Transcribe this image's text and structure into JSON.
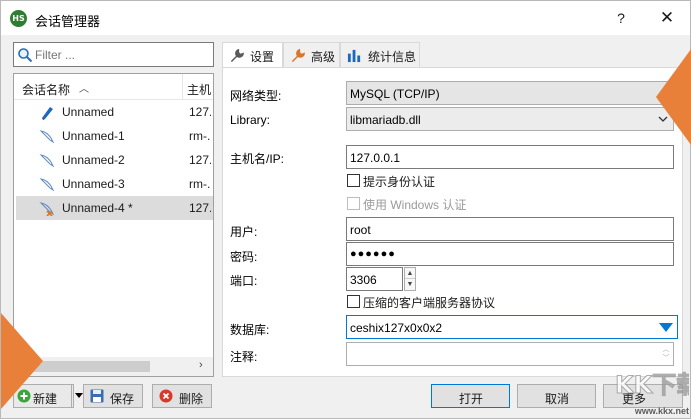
{
  "window": {
    "title": "会话管理器",
    "app_icon_text": "HS",
    "help_label": "?",
    "close_label": "✕"
  },
  "filter": {
    "placeholder": "Filter ..."
  },
  "session_list": {
    "columns": [
      "会话名称",
      "主机"
    ],
    "sessions": [
      {
        "name": "Unnamed",
        "host": "127.",
        "icon": "dolphin-icon-blue",
        "selected": false
      },
      {
        "name": "Unnamed-1",
        "host": "rm-.",
        "icon": "dolphin-icon-gray",
        "selected": false
      },
      {
        "name": "Unnamed-2",
        "host": "127.",
        "icon": "dolphin-icon-gray",
        "selected": false
      },
      {
        "name": "Unnamed-3",
        "host": "rm-.",
        "icon": "dolphin-icon-gray",
        "selected": false
      },
      {
        "name": "Unnamed-4 *",
        "host": "127.",
        "icon": "dolphin-icon-orange",
        "selected": true
      }
    ]
  },
  "tabs": [
    {
      "label": "设置",
      "icon": "wrench-icon",
      "active": true
    },
    {
      "label": "高级",
      "icon": "wrench-orange-icon",
      "active": false
    },
    {
      "label": "统计信息",
      "icon": "bar-chart-icon",
      "active": false
    }
  ],
  "settings": {
    "network_type_label": "网络类型:",
    "network_type_value": "MySQL (TCP/IP)",
    "library_label": "Library:",
    "library_value": "libmariadb.dll",
    "hostname_label": "主机名/IP:",
    "hostname_value": "127.0.0.1",
    "prompt_auth_label": "提示身份认证",
    "windows_auth_label": "使用 Windows 认证",
    "user_label": "用户:",
    "user_value": "root",
    "password_label": "密码:",
    "password_value": "●●●●●●",
    "port_label": "端口:",
    "port_value": "3306",
    "compress_label": "压缩的客户端服务器协议",
    "database_label": "数据库:",
    "database_value": "ceshix127x0x0x2",
    "comment_label": "注释:",
    "comment_value": ""
  },
  "buttons": {
    "new": "新建",
    "save": "保存",
    "delete": "删除",
    "open": "打开",
    "cancel": "取消",
    "more": "更多"
  },
  "watermark": {
    "text": "www.kkx.net",
    "logo_text": "KK下载"
  },
  "colors": {
    "accent": "#0078d7",
    "selection": "#dcdcdc",
    "deco_orange": "#e8803a"
  }
}
